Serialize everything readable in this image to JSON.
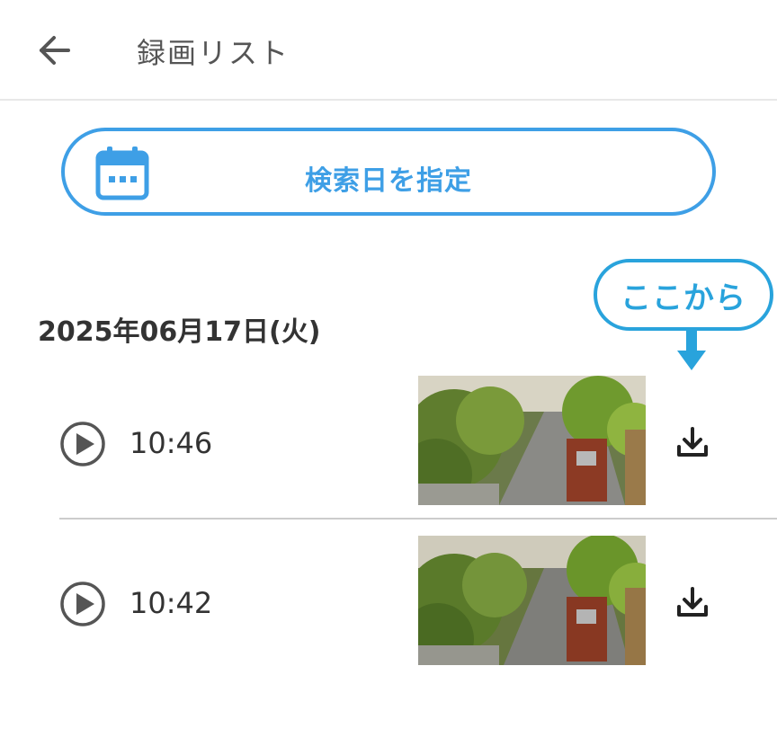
{
  "header": {
    "title": "録画リスト",
    "back_icon": "arrow-left-icon"
  },
  "search": {
    "label": "検索日を指定",
    "icon": "calendar-icon",
    "accent_color": "#3e9fe6"
  },
  "callout": {
    "text": "ここから",
    "color": "#29a3dc"
  },
  "date_group": {
    "heading": "2025年06月17日(火)"
  },
  "recordings": [
    {
      "time": "10:46"
    },
    {
      "time": "10:42"
    }
  ]
}
